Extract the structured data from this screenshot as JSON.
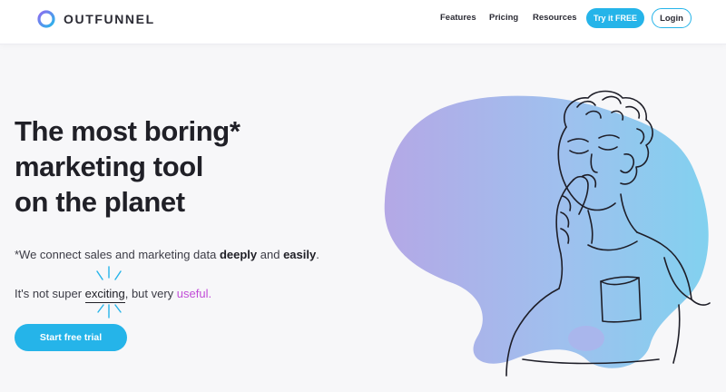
{
  "brand": {
    "name": "OUTFUNNEL"
  },
  "nav": {
    "features": "Features",
    "pricing": "Pricing",
    "resources": "Resources",
    "try_free": "Try it FREE",
    "login": "Login"
  },
  "hero": {
    "title_lines": [
      "The most boring*",
      "marketing tool",
      "on the planet"
    ],
    "sub1_prefix": "*We connect sales and marketing data ",
    "sub1_deeply": "deeply",
    "sub1_and": " and ",
    "sub1_easily": "easily",
    "sub1_suffix": ".",
    "sub2_prefix": "It's not super ",
    "sub2_exciting": "exciting",
    "sub2_middle": ", but very ",
    "sub2_useful": "useful.",
    "cta": "Start free trial"
  },
  "colors": {
    "accent": "#25b4e9",
    "highlight": "#c24dd8",
    "text_dark": "#202027",
    "blob_left": "#b3a9e6",
    "blob_right": "#86d0ee"
  },
  "icons": {
    "logo": "outfunnel-ring-logo",
    "sparks": "emphasis-sparks-icon",
    "illustration": "yawning-person-illustration"
  }
}
